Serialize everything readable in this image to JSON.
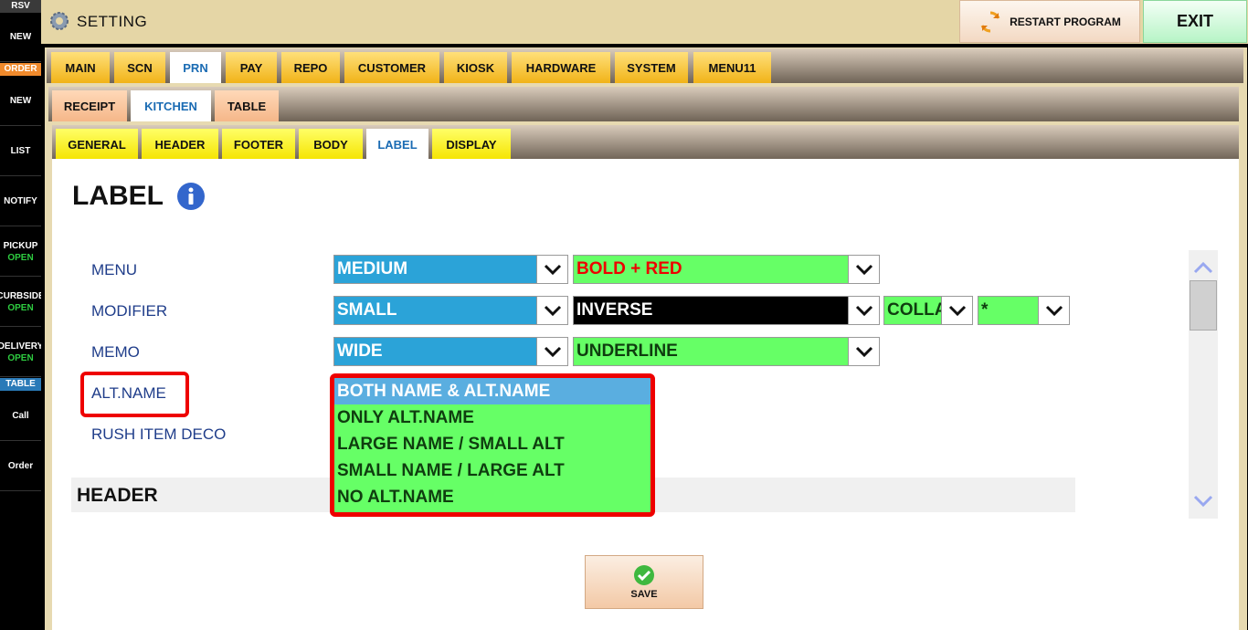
{
  "sidebar": {
    "rsv_header": "RSV",
    "order_header": "ORDER",
    "table_header": "TABLE",
    "items": [
      {
        "label": "NEW",
        "sub": ""
      },
      {
        "label": "NEW",
        "sub": ""
      },
      {
        "label": "LIST",
        "sub": ""
      },
      {
        "label": "NOTIFY",
        "sub": ""
      },
      {
        "label": "PICKUP",
        "sub": "OPEN"
      },
      {
        "label": "CURBSIDE",
        "sub": "OPEN"
      },
      {
        "label": "DELIVERY",
        "sub": "OPEN"
      },
      {
        "label": "Call",
        "sub": ""
      },
      {
        "label": "Order",
        "sub": ""
      }
    ]
  },
  "topbar": {
    "title": "SETTING",
    "restart_label": "RESTART PROGRAM",
    "exit_label": "EXIT"
  },
  "tabs_level1": [
    "MAIN",
    "SCN",
    "PRN",
    "PAY",
    "REPO",
    "CUSTOMER",
    "KIOSK",
    "HARDWARE",
    "SYSTEM",
    "MENU11"
  ],
  "tabs_level2": [
    "RECEIPT",
    "KITCHEN",
    "TABLE"
  ],
  "tabs_level3": [
    "GENERAL",
    "HEADER",
    "FOOTER",
    "BODY",
    "LABEL",
    "DISPLAY"
  ],
  "content": {
    "title": "LABEL",
    "rows": [
      {
        "label": "MENU",
        "size": "MEDIUM",
        "style": "BOLD + RED"
      },
      {
        "label": "MODIFIER",
        "size": "SMALL",
        "style": "INVERSE",
        "extra1": "COLLAPSE",
        "extra2": "*"
      },
      {
        "label": "MEMO",
        "size": "WIDE",
        "style": "UNDERLINE"
      },
      {
        "label": "ALT.NAME"
      },
      {
        "label": "RUSH ITEM DECO"
      }
    ],
    "alt_name_options": [
      "BOTH NAME & ALT.NAME",
      "ONLY ALT.NAME",
      "LARGE NAME / SMALL ALT",
      "SMALL NAME / LARGE ALT",
      "NO ALT.NAME"
    ],
    "section_header": "HEADER",
    "save_label": "SAVE"
  }
}
